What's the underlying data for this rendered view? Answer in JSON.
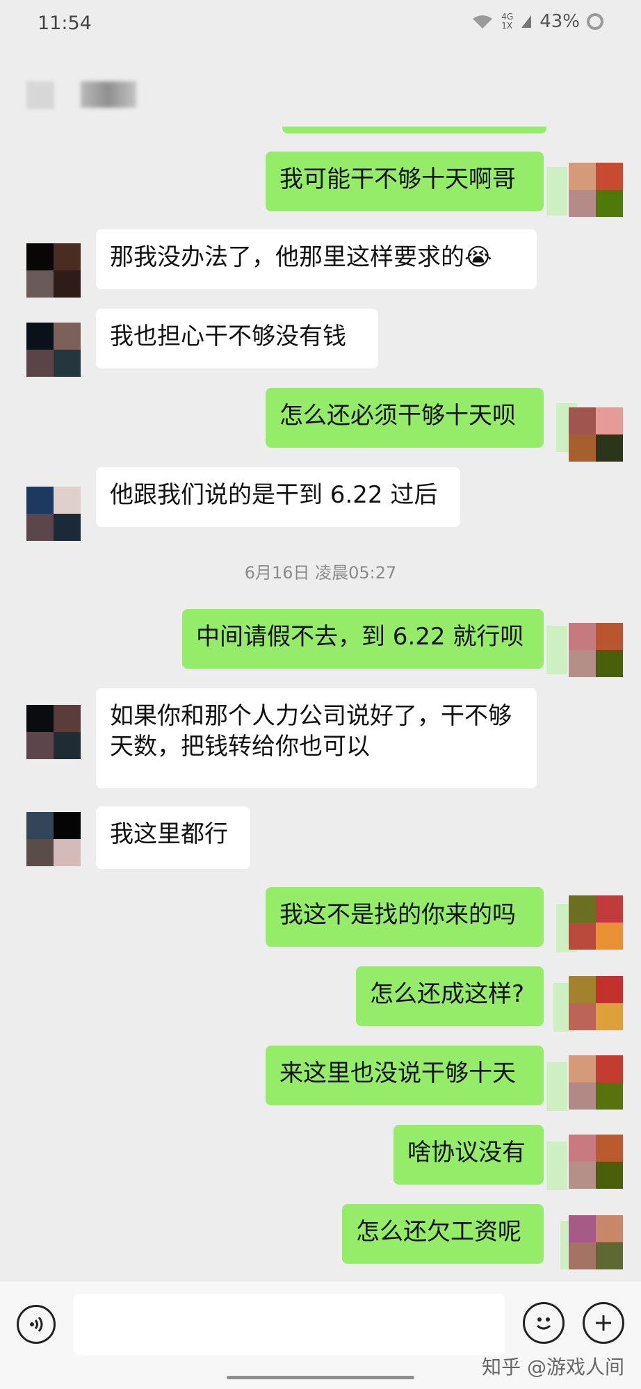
{
  "status_bar": {
    "time": "11:54",
    "network_top": "4G",
    "network_bottom": "1X",
    "battery": "43%"
  },
  "timestamp": "6月16日 凌晨05:27",
  "messages": [
    {
      "side": "right",
      "text": "我可能干不够十天啊哥"
    },
    {
      "side": "left",
      "text": "那我没办法了，他那里这样要求的😭"
    },
    {
      "side": "left",
      "text": "我也担心干不够没有钱"
    },
    {
      "side": "right",
      "text": "怎么还必须干够十天呗"
    },
    {
      "side": "left",
      "text": "他跟我们说的是干到 6.22 过后"
    },
    {
      "side": "right",
      "text": "中间请假不去，到 6.22 就行呗"
    },
    {
      "side": "left",
      "text": "如果你和那个人力公司说好了，干不够天数，把钱转给你也可以"
    },
    {
      "side": "left",
      "text": "我这里都行"
    },
    {
      "side": "right",
      "text": "我这不是找的你来的吗"
    },
    {
      "side": "right",
      "text": "怎么还成这样?"
    },
    {
      "side": "right",
      "text": "来这里也没说干够十天"
    },
    {
      "side": "right",
      "text": "啥协议没有"
    },
    {
      "side": "right",
      "text": "怎么还欠工资呢"
    }
  ],
  "input_bar": {
    "placeholder": "",
    "voice_icon": "voice-icon",
    "emoji_icon": "emoji-icon",
    "plus_icon": "plus-icon"
  },
  "watermark": "知乎 @游戏人间",
  "colors": {
    "background": "#ededed",
    "right_bubble": "#95ec69",
    "left_bubble": "#ffffff"
  }
}
